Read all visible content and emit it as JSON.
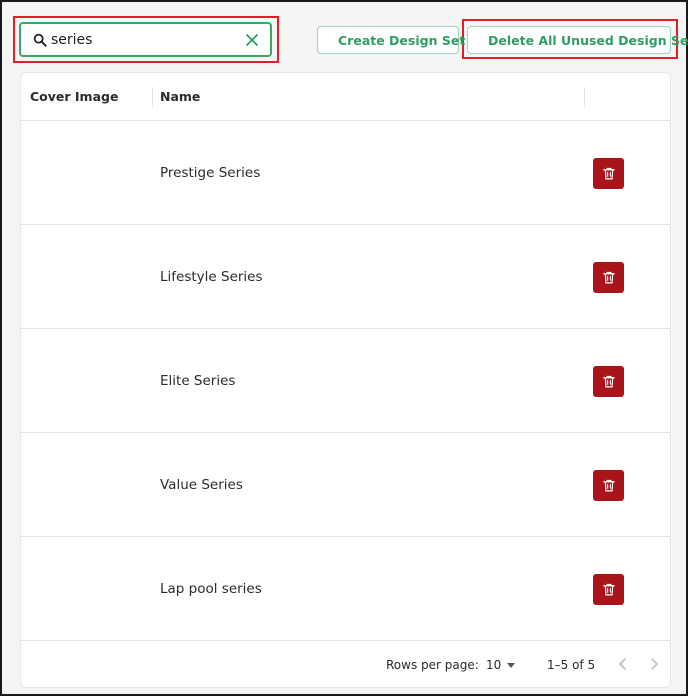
{
  "search": {
    "value": "series",
    "placeholder": ""
  },
  "toolbar": {
    "create_label": "Create Design Set",
    "delete_all_label": "Delete All Unused Design Sets"
  },
  "table": {
    "columns": [
      "Cover Image",
      "Name"
    ],
    "rows": [
      {
        "name": "Prestige Series"
      },
      {
        "name": "Lifestyle Series"
      },
      {
        "name": "Elite Series"
      },
      {
        "name": "Value Series"
      },
      {
        "name": "Lap pool series"
      }
    ]
  },
  "pagination": {
    "rows_per_page_label": "Rows per page:",
    "rows_per_page": "10",
    "range": "1–5 of 5"
  },
  "colors": {
    "accent": "#2e9e63",
    "danger": "#a9141a",
    "highlight": "#e11d2a"
  }
}
